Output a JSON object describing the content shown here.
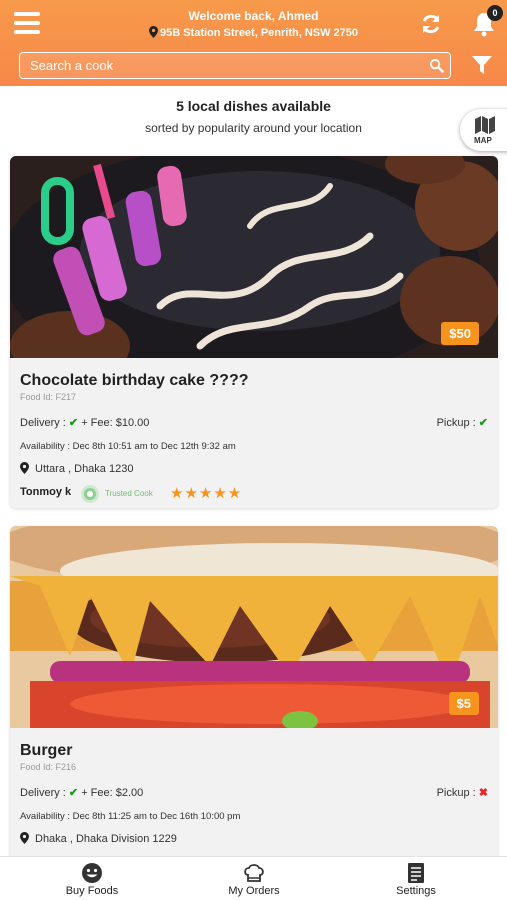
{
  "header": {
    "welcome": "Welcome back, Ahmed",
    "address": "95B Station Street, Penrith, NSW 2750",
    "notification_count": "0",
    "search_placeholder": "Search a cook",
    "icons": [
      "menu-icon",
      "refresh-icon",
      "bell-icon",
      "search-icon",
      "filter-icon"
    ]
  },
  "listing": {
    "count_text": "5 local dishes available",
    "sort_text": "sorted by popularity around your location",
    "map_label": "MAP"
  },
  "dishes": [
    {
      "title": "Chocolate birthday cake ????",
      "food_id": "Food Id: F217",
      "price": "$50",
      "delivery_label": "Delivery :",
      "delivery_fee": "+ Fee: $10.00",
      "delivery_available": true,
      "pickup_label": "Pickup :",
      "pickup_available": true,
      "availability": "Availability : Dec 8th 10:51 am to Dec 12th 9:32 am",
      "location": "Uttara , Dhaka   1230",
      "cook_name": "Tonmoy k",
      "trusted_label": "Trusted Cook",
      "rating": 5,
      "stars": "★★★★★"
    },
    {
      "title": "Burger",
      "food_id": "Food Id: F216",
      "price": "$5",
      "delivery_label": "Delivery :",
      "delivery_fee": "+ Fee: $2.00",
      "delivery_available": true,
      "pickup_label": "Pickup :",
      "pickup_available": false,
      "availability": "Availability : Dec 8th 11:25 am to Dec 16th 10:00 pm",
      "location": "Dhaka , Dhaka Division   1229"
    }
  ],
  "nav": {
    "buy_foods": "Buy Foods",
    "my_orders": "My Orders",
    "settings": "Settings"
  },
  "colors": {
    "accent": "#f7894a",
    "price_badge": "#f7941d",
    "check": "#1a9a1a",
    "cross": "#e22222"
  }
}
